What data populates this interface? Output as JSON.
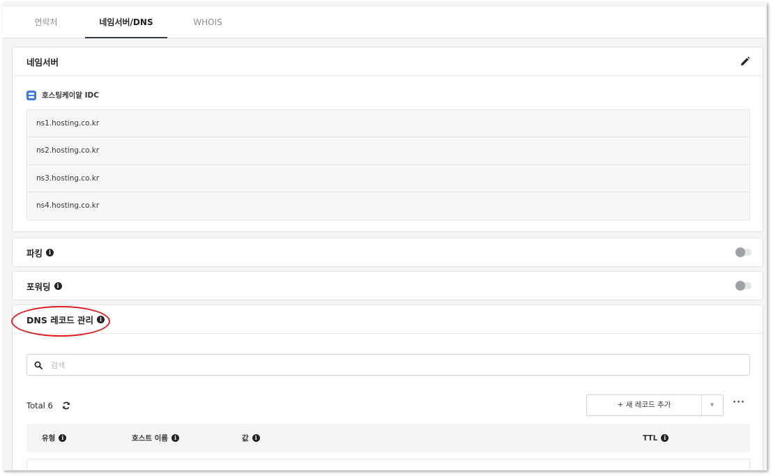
{
  "tabs": [
    {
      "label": "연락처",
      "active": false
    },
    {
      "label": "네임서버/DNS",
      "active": true
    },
    {
      "label": "WHOIS",
      "active": false
    }
  ],
  "nameserver": {
    "title": "네임서버",
    "edit_icon": "pencil-icon",
    "provider": "호스팅케이알 IDC",
    "provider_icon": "server-icon",
    "servers": [
      "ns1.hosting.co.kr",
      "ns2.hosting.co.kr",
      "ns3.hosting.co.kr",
      "ns4.hosting.co.kr"
    ]
  },
  "parking": {
    "title": "파킹",
    "enabled": false
  },
  "forwarding": {
    "title": "포워딩",
    "enabled": false
  },
  "dns": {
    "title": "DNS 레코드 관리",
    "search_placeholder": "검색",
    "total_label": "Total 6",
    "add_record_label": "+ 새 레코드 추가",
    "more_label": "···",
    "columns": [
      "유형",
      "호스트 이름",
      "값",
      "TTL"
    ]
  },
  "colors": {
    "active_tab_underline": "#2d3b45",
    "provider_icon_bg": "#3d7be0",
    "annotation_red": "#e01b1b"
  }
}
